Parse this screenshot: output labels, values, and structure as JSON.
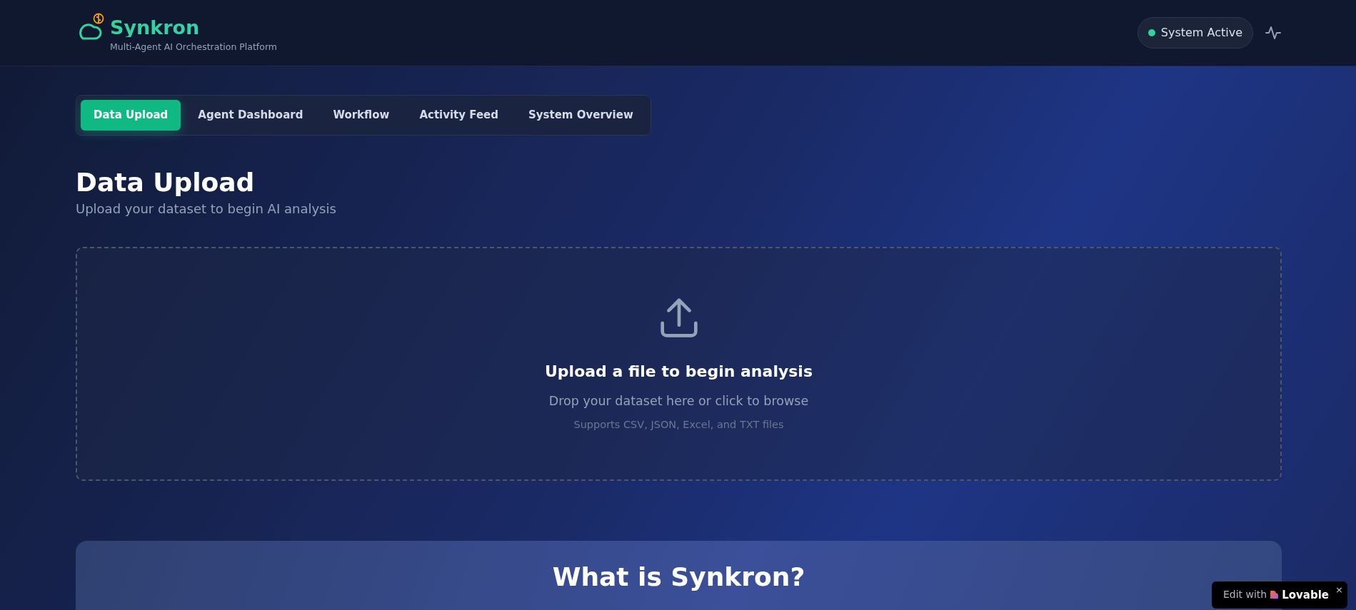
{
  "header": {
    "title": "Synkron",
    "subtitle": "Multi-Agent AI Orchestration Platform",
    "status": {
      "label": "System Active",
      "active": true,
      "color": "#34d399"
    }
  },
  "tabs": [
    {
      "label": "Data Upload",
      "selected": true
    },
    {
      "label": "Agent Dashboard",
      "selected": false
    },
    {
      "label": "Workflow",
      "selected": false
    },
    {
      "label": "Activity Feed",
      "selected": false
    },
    {
      "label": "System Overview",
      "selected": false
    }
  ],
  "page": {
    "heading": "Data Upload",
    "subheading": "Upload your dataset to begin AI analysis"
  },
  "dropzone": {
    "title": "Upload a file to begin analysis",
    "hint": "Drop your dataset here or click to browse",
    "formats": "Supports CSV, JSON, Excel, and TXT files"
  },
  "about": {
    "title": "What is Synkron?"
  },
  "badge": {
    "prefix": "Edit with",
    "brand": "Lovable",
    "close": "×"
  }
}
